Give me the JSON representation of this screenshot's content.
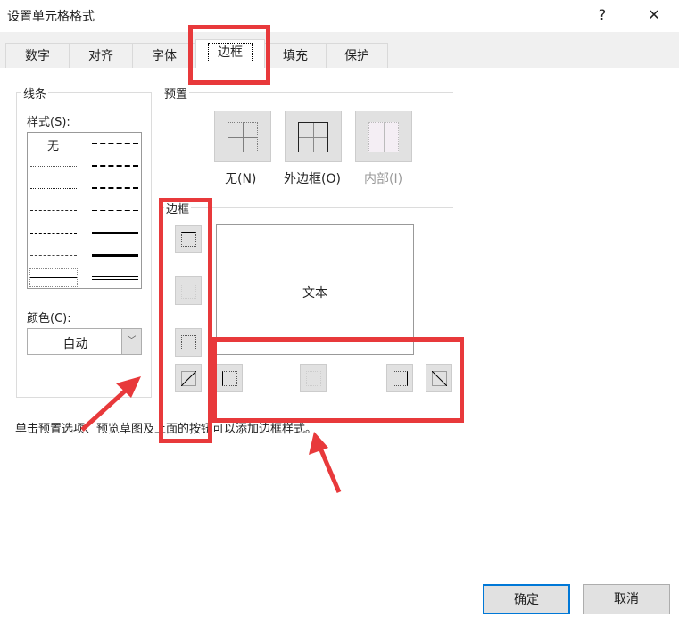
{
  "dialog": {
    "title": "设置单元格格式",
    "help": "?",
    "close": "✕"
  },
  "tabs": [
    {
      "label": "数字"
    },
    {
      "label": "对齐"
    },
    {
      "label": "字体"
    },
    {
      "label": "边框"
    },
    {
      "label": "填充"
    },
    {
      "label": "保护"
    }
  ],
  "line": {
    "group": "线条",
    "style_label": "样式(S):",
    "none": "无",
    "color_label": "颜色(C):",
    "color_value": "自动"
  },
  "presets": {
    "group": "预置",
    "items": [
      {
        "label": "无(N)"
      },
      {
        "label": "外边框(O)"
      },
      {
        "label": "内部(I)"
      }
    ]
  },
  "border": {
    "group": "边框",
    "preview_text": "文本"
  },
  "hint": "单击预置选项、预览草图及上面的按钮可以添加边框样式。",
  "buttons": {
    "ok": "确定",
    "cancel": "取消"
  },
  "colors": {
    "annotation": "#e8393b",
    "accent": "#0078d7"
  }
}
